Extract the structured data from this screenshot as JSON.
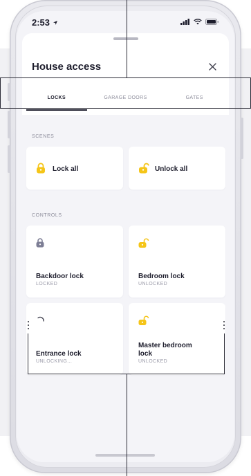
{
  "status_bar": {
    "time": "2:53"
  },
  "sheet": {
    "title": "House access"
  },
  "tabs": [
    {
      "label": "LOCKS",
      "active": true
    },
    {
      "label": "GARAGE DOORS",
      "active": false
    },
    {
      "label": "GATES",
      "active": false
    }
  ],
  "scenes": {
    "label": "SCENES",
    "items": [
      {
        "label": "Lock all",
        "icon": "lock-closed-icon"
      },
      {
        "label": "Unlock all",
        "icon": "lock-open-icon"
      }
    ]
  },
  "controls": {
    "label": "CONTROLS",
    "items": [
      {
        "name": "Backdoor lock",
        "state": "LOCKED",
        "icon": "lock-closed-icon"
      },
      {
        "name": "Bedroom lock",
        "state": "UNLOCKED",
        "icon": "lock-open-icon"
      },
      {
        "name": "Entrance lock",
        "state": "UNLOCKING...",
        "icon": "spinner-icon"
      },
      {
        "name": "Master bedroom lock",
        "state": "UNLOCKED",
        "icon": "lock-open-icon"
      }
    ]
  },
  "colors": {
    "accent_yellow": "#f5c518",
    "text_dark": "#1d1d2c",
    "text_muted": "#8d8d9b",
    "locked_gray": "#7d7e95"
  }
}
